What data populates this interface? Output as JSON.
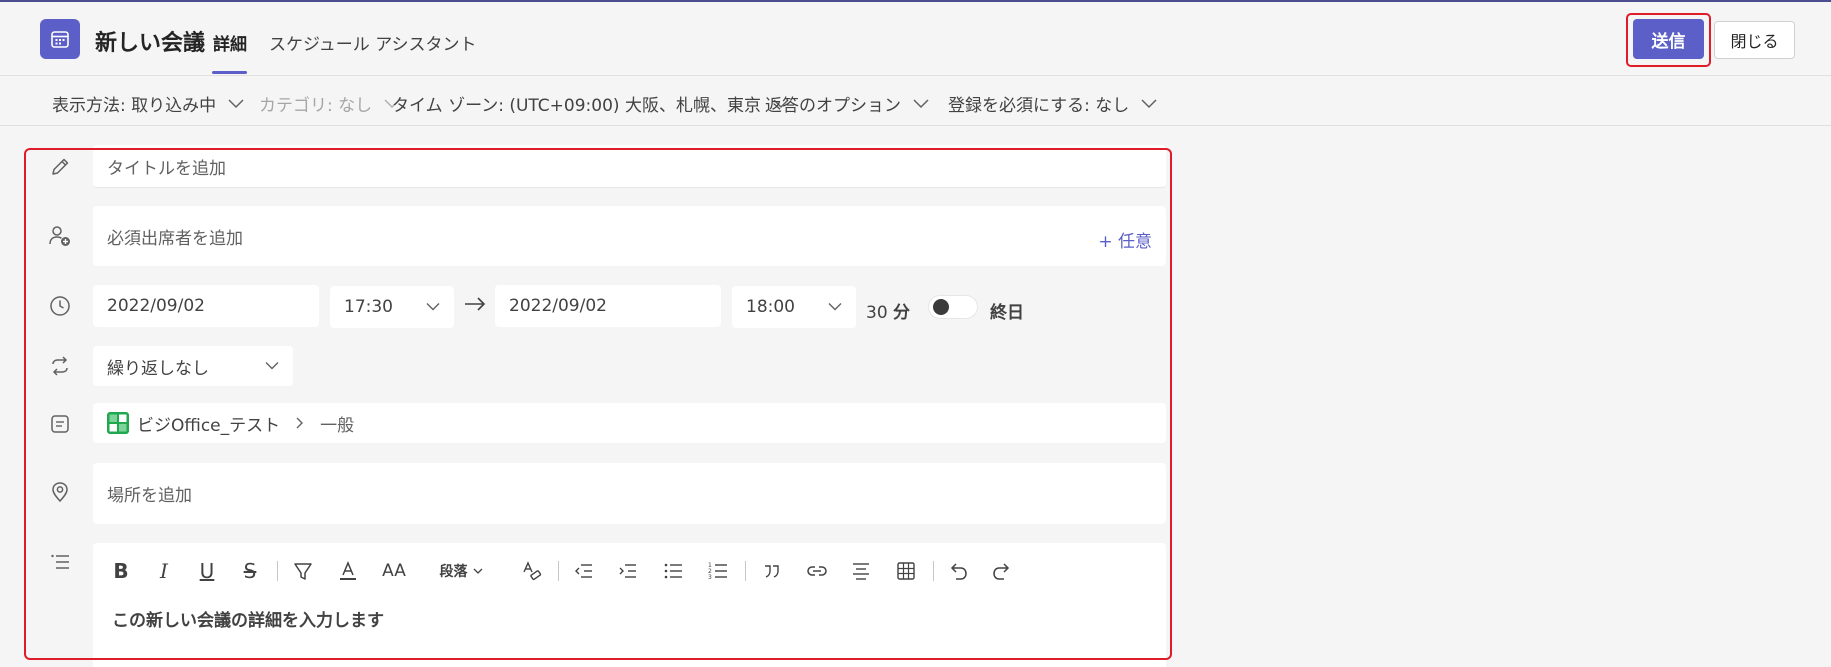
{
  "header": {
    "title": "新しい会議",
    "tabs": [
      {
        "label": "詳細",
        "active": true
      },
      {
        "label": "スケジュール アシスタント",
        "active": false
      }
    ],
    "send_label": "送信",
    "close_label": "閉じる"
  },
  "options": {
    "show_as": "表示方法: 取り込み中",
    "category": "カテゴリ: なし",
    "timezone": "タイム ゾーン: (UTC+09:00) 大阪、札幌、東京",
    "response_options": "返答のオプション",
    "registration": "登録を必須にする: なし"
  },
  "form": {
    "title_placeholder": "タイトルを追加",
    "attendees_placeholder": "必須出席者を追加",
    "optional_link": "+ 任意",
    "start_date": "2022/09/02",
    "start_time": "17:30",
    "end_date": "2022/09/02",
    "end_time": "18:00",
    "duration": "30",
    "duration_unit": "分",
    "all_day_label": "終日",
    "all_day_on": false,
    "repeat": "繰り返しなし",
    "channel_team": "ビジOffice_テスト",
    "channel_name": "一般",
    "location_placeholder": "場所を追加",
    "paragraph_label": "段落",
    "details_placeholder": "この新しい会議の詳細を入力します"
  },
  "colors": {
    "accent": "#5b5fc7",
    "highlight": "#e01c2a"
  }
}
